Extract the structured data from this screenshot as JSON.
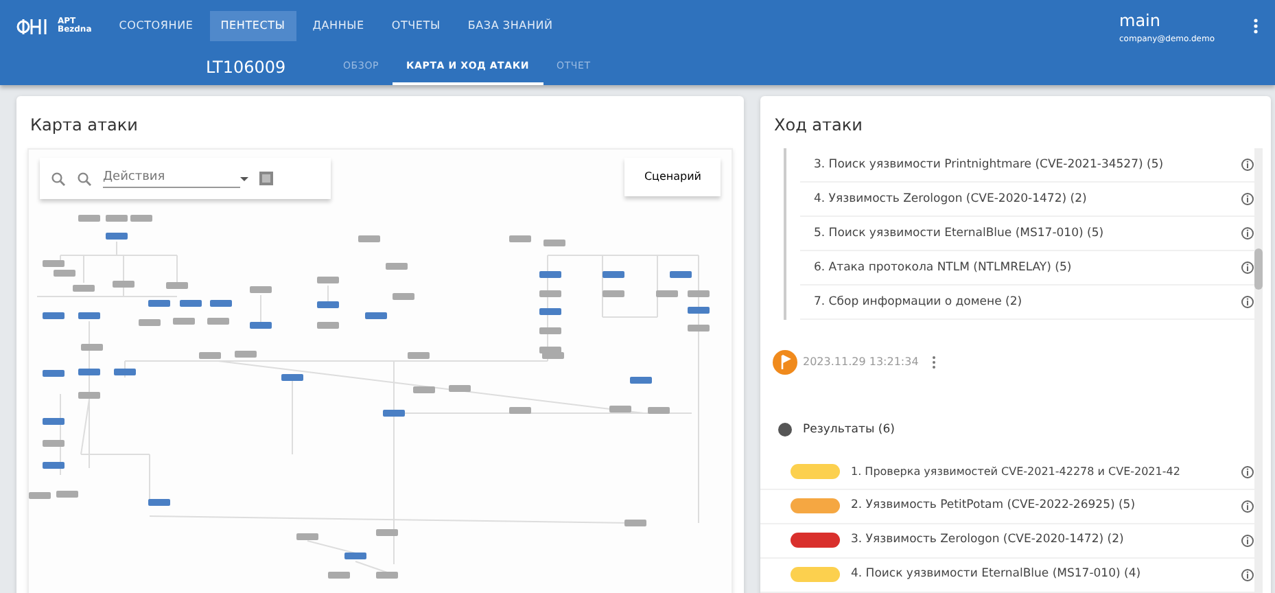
{
  "header": {
    "logo": {
      "line1": "APT",
      "line2": "Bezdna"
    },
    "nav": [
      {
        "label": "СОСТОЯНИЕ",
        "selected": false
      },
      {
        "label": "ПЕНТЕСТЫ",
        "selected": true
      },
      {
        "label": "ДАННЫЕ",
        "selected": false
      },
      {
        "label": "ОТЧЕТЫ",
        "selected": false
      },
      {
        "label": "БАЗА ЗНАНИЙ",
        "selected": false
      }
    ],
    "user": {
      "name": "main",
      "email": "company@demo.demo"
    }
  },
  "subheader": {
    "title": "LT106009",
    "tabs": [
      {
        "label": "ОБЗОР",
        "selected": false
      },
      {
        "label": "КАРТА И ХОД АТАКИ",
        "selected": true
      },
      {
        "label": "ОТЧЕТ",
        "selected": false
      }
    ]
  },
  "attack_map": {
    "title": "Карта атаки",
    "search": {
      "placeholder": "Действия"
    },
    "scenario_button": "Сценарий"
  },
  "attack_progress": {
    "title": "Ход атаки",
    "steps": [
      {
        "text": "3. Поиск уязвимости Printnightmare (CVE-2021-34527) (5)"
      },
      {
        "text": "4. Уязвимость Zerologon (CVE-2020-1472) (2)"
      },
      {
        "text": "5. Поиск уязвимости EternalBlue (MS17-010) (5)"
      },
      {
        "text": "6. Атака протокола NTLM (NTLMRELAY) (5)"
      },
      {
        "text": "7. Сбор информации о домене (2)"
      }
    ],
    "checkpoint": {
      "timestamp": "2023.11.29 13:21:34"
    },
    "results": {
      "title": "Результаты (6)",
      "items": [
        {
          "text": "1. Проверка уязвимостей CVE-2021-42278 и CVE-2021-42",
          "color": "#fcd04e"
        },
        {
          "text": "2. Уязвимость PetitPotam (CVE-2022-26925) (5)",
          "color": "#f5a742"
        },
        {
          "text": "3. Уязвимость Zerologon (CVE-2020-1472) (2)",
          "color": "#d9302c"
        },
        {
          "text": "4. Поиск уязвимости EternalBlue (MS17-010) (4)",
          "color": "#fcd04e"
        }
      ]
    }
  }
}
